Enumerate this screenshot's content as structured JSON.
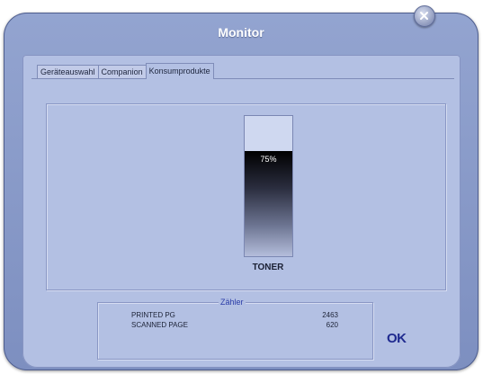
{
  "window": {
    "title": "Monitor"
  },
  "tabs": [
    {
      "label": "Geräteauswahl",
      "active": false
    },
    {
      "label": "Companion",
      "active": false
    },
    {
      "label": "Konsumprodukte",
      "active": true
    }
  ],
  "toner": {
    "label": "TONER",
    "level_percent": 75,
    "level_text": "75%"
  },
  "counter": {
    "legend": "Zähler",
    "rows": [
      {
        "label": "PRINTED PG",
        "value": "2463"
      },
      {
        "label": "SCANNED PAGE",
        "value": "620"
      }
    ]
  },
  "buttons": {
    "ok_label": "OK"
  },
  "icons": {
    "close": "close-icon"
  },
  "colors": {
    "window": "#8696c7",
    "client": "#b3c0e3",
    "ok": "#1f2a8f",
    "legend": "#2b3ca8"
  }
}
